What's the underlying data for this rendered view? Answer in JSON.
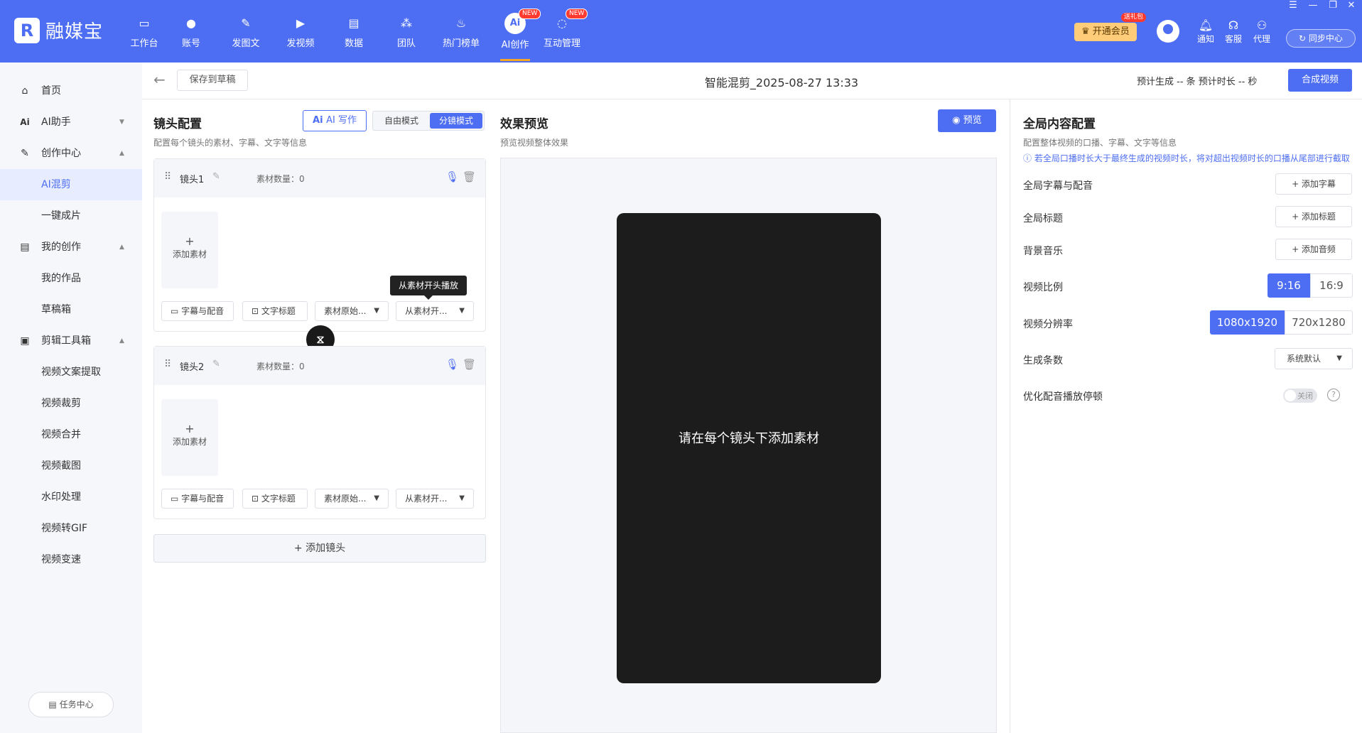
{
  "app": {
    "logo_text": "融媒宝",
    "logo_mark": "R"
  },
  "nav": [
    {
      "label": "工作台",
      "icon": "monitor-icon"
    },
    {
      "label": "账号",
      "icon": "user-icon"
    },
    {
      "label": "发图文",
      "icon": "feather-icon"
    },
    {
      "label": "发视频",
      "icon": "play-icon"
    },
    {
      "label": "数据",
      "icon": "chart-icon"
    },
    {
      "label": "团队",
      "icon": "team-icon"
    },
    {
      "label": "热门榜单",
      "icon": "fire-icon"
    },
    {
      "label": "AI创作",
      "icon": "ai-icon",
      "badge": "NEW",
      "active": true,
      "icon_text": "Ai"
    },
    {
      "label": "互动管理",
      "icon": "chat-icon",
      "badge": "NEW"
    }
  ],
  "header_right": {
    "vip_label": "开通会员",
    "vip_gift": "送礼包",
    "tools": [
      {
        "label": "通知",
        "icon": "bell-icon"
      },
      {
        "label": "客服",
        "icon": "headset-icon"
      },
      {
        "label": "代理",
        "icon": "agent-icon"
      }
    ],
    "sync_label": "同步中心"
  },
  "sidebar": {
    "items": [
      {
        "label": "首页",
        "icon": "home-icon"
      },
      {
        "label": "AI助手",
        "icon": "ai-icon",
        "caret": "down"
      },
      {
        "label": "创作中心",
        "icon": "pen-icon",
        "caret": "up"
      },
      {
        "label": "AI混剪",
        "active": true
      },
      {
        "label": "一键成片"
      },
      {
        "label": "我的创作",
        "icon": "doc-icon",
        "caret": "up"
      },
      {
        "label": "我的作品"
      },
      {
        "label": "草稿箱"
      },
      {
        "label": "剪辑工具箱",
        "icon": "toolbox-icon",
        "caret": "up"
      },
      {
        "label": "视频文案提取"
      },
      {
        "label": "视频裁剪"
      },
      {
        "label": "视频合并"
      },
      {
        "label": "视频截图"
      },
      {
        "label": "水印处理"
      },
      {
        "label": "视频转GIF"
      },
      {
        "label": "视频变速"
      }
    ],
    "task_center": "任务中心"
  },
  "toolbar": {
    "save_draft": "保存到草稿",
    "title": "智能混剪_2025-08-27 13:33",
    "est_info": "预计生成 -- 条   预计时长 -- 秒",
    "compose": "合成视频"
  },
  "shot_config": {
    "title": "镜头配置",
    "subtitle": "配置每个镜头的素材、字幕、文字等信息",
    "ai_write": "AI 写作",
    "mode_free": "自由模式",
    "mode_shot": "分镜模式",
    "shots": [
      {
        "name": "镜头1",
        "count_label": "素材数量：0",
        "add_material": "添加素材",
        "opts": [
          "字幕与配音",
          "文字标题",
          "素材原始...",
          "从素材开..."
        ]
      },
      {
        "name": "镜头2",
        "count_label": "素材数量：0",
        "add_material": "添加素材",
        "opts": [
          "字幕与配音",
          "文字标题",
          "素材原始...",
          "从素材开..."
        ]
      }
    ],
    "tooltip": "从素材开头播放",
    "add_shot": "+ 添加镜头"
  },
  "preview": {
    "title": "效果预览",
    "subtitle": "预览视频整体效果",
    "preview_btn": "预览",
    "placeholder": "请在每个镜头下添加素材"
  },
  "global": {
    "title": "全局内容配置",
    "subtitle": "配置整体视频的口播、字幕、文字等信息",
    "note": "ⓘ 若全局口播时长大于最终生成的视频时长，将对超出视频时长的口播从尾部进行截取",
    "rows": {
      "subtitle_label": "全局字幕与配音",
      "subtitle_btn": "+ 添加字幕",
      "title_label": "全局标题",
      "title_btn": "+ 添加标题",
      "music_label": "背景音乐",
      "music_btn": "+ 添加音频",
      "ratio_label": "视频比例",
      "ratio_options": [
        "9:16",
        "16:9"
      ],
      "ratio_selected": "9:16",
      "res_label": "视频分辨率",
      "res_options": [
        "1080x1920",
        "720x1280"
      ],
      "res_selected": "1080x1920",
      "count_label": "生成条数",
      "count_value": "系统默认",
      "optimize_label": "优化配音播放停顿",
      "optimize_state": "关闭"
    }
  },
  "colors": {
    "accent": "#4d6ef3",
    "preview_bg": "#1c1c1c"
  }
}
